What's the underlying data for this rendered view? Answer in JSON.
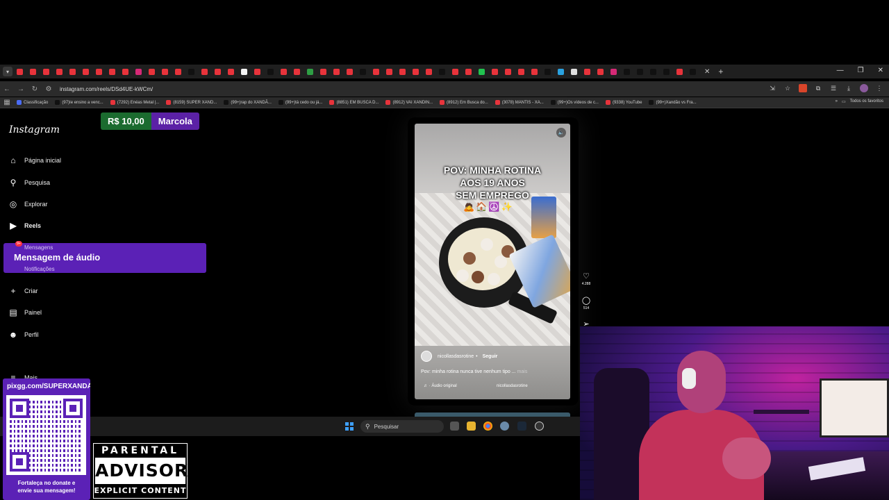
{
  "browser": {
    "url": "instagram.com/reels/DSd4UE-kWCm/",
    "tab_favicon_colors": [
      "#e8333b",
      "#e8333b",
      "#e8333b",
      "#e8333b",
      "#e8333b",
      "#e8333b",
      "#e8333b",
      "#e8333b",
      "#e8333b",
      "#d62976",
      "#e8333b",
      "#e8333b",
      "#e8333b",
      "#111111",
      "#e8333b",
      "#e8333b",
      "#e8333b",
      "#f5f5f5",
      "#e8333b",
      "#111111",
      "#e8333b",
      "#e8333b",
      "#2e9e44",
      "#e8333b",
      "#e8333b",
      "#e8333b",
      "#111111",
      "#e8333b",
      "#e8333b",
      "#e8333b",
      "#e8333b",
      "#e8333b",
      "#111111",
      "#e8333b",
      "#e8333b",
      "#21c24f",
      "#e8333b",
      "#e8333b",
      "#e8333b",
      "#e8333b",
      "#111111",
      "#2aa2e0",
      "#e0e0e0",
      "#e8333b",
      "#e8333b",
      "#d62976",
      "#111111",
      "#111111",
      "#111111",
      "#111111",
      "#e8333b",
      "#111111"
    ],
    "bookmarks": [
      {
        "label": "Classificação",
        "color": "#4a6cf7"
      },
      {
        "label": "(97)Ie ensino a venc...",
        "color": "#111111"
      },
      {
        "label": "(7292) Enéas Metal |...",
        "color": "#e8333b"
      },
      {
        "label": "(8159) SUPER XAND...",
        "color": "#e8333b"
      },
      {
        "label": "(99+)rap do XANDÃ...",
        "color": "#111111"
      },
      {
        "label": "(99+)tá cedo ou já...",
        "color": "#111111"
      },
      {
        "label": "(8851) EM BUSCA D...",
        "color": "#e8333b"
      },
      {
        "label": "(8912) VAI XANDIN...",
        "color": "#e8333b"
      },
      {
        "label": "(8912) Em Busca do...",
        "color": "#e8333b"
      },
      {
        "label": "(3078) MANTIS - XA...",
        "color": "#e8333b"
      },
      {
        "label": "(99+)Os vídeos de c...",
        "color": "#111111"
      },
      {
        "label": "(9338) YouTube",
        "color": "#e8333b"
      },
      {
        "label": "(99+)Xandão vs Fra...",
        "color": "#111111"
      }
    ],
    "bookmarks_more": "»",
    "all_favorites": "Todos os favoritos"
  },
  "instagram": {
    "logo": "Instagram",
    "nav": {
      "home": "Página inicial",
      "search": "Pesquisa",
      "explore": "Explorar",
      "reels": "Reels",
      "create": "Criar",
      "dashboard": "Painel",
      "profile": "Perfil",
      "more": "Mais"
    },
    "reel": {
      "title_line1": "POV: MINHA ROTINA",
      "title_line2": "AOS 19 ANOS",
      "title_line3": "SEM EMPREGO",
      "emoji": "🙇🏠☮️✨",
      "username": "nicollasdasrotine",
      "follow": "Seguir",
      "caption": "Pov: minha rotina nunca tive nenhum tipo ...",
      "caption_more": "mais",
      "audio": "♬ · Áudio original",
      "audio_user": "nicollasdasrotine",
      "likes": "4.288",
      "comments": "514"
    }
  },
  "stream_overlay": {
    "donation_amount": "R$ 10,00",
    "donation_name": "Marcola",
    "audio_msg_sub_top": "Mensagens",
    "audio_msg_title": "Mensagem de áudio",
    "audio_msg_sub_bottom": "Notificações",
    "notif_badge": "9+",
    "pix_url": "pixgg.com/SUPERXANDÃO",
    "pix_cta_line1": "Fortaleça no donate e",
    "pix_cta_line2": "envie sua mensagem!",
    "pa_top": "PARENTAL",
    "pa_mid": "ADVISORY",
    "pa_bot": "EXPLICIT CONTENT"
  },
  "taskbar": {
    "search_placeholder": "Pesquisar"
  }
}
